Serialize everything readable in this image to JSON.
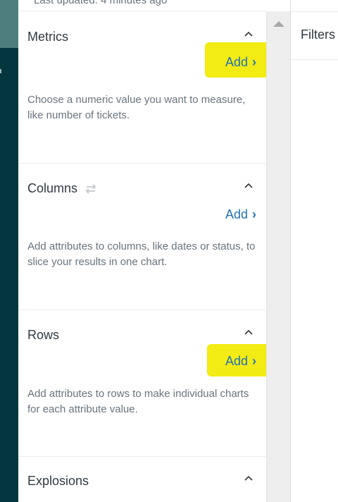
{
  "panel": {
    "updated_text": "Last updated: 4 minutes ago",
    "sections": [
      {
        "title": "Metrics",
        "add_label": "Add",
        "add_chevron": "›",
        "description": "Choose a numeric value you want to measure, like number of tickets.",
        "highlighted": true
      },
      {
        "title": "Columns",
        "icon": "swap-arrows-icon",
        "add_label": "Add",
        "add_chevron": "›",
        "description": "Add attributes to columns, like dates or status, to slice your results in one chart.",
        "highlighted": false
      },
      {
        "title": "Rows",
        "add_label": "Add",
        "add_chevron": "›",
        "description": "Add attributes to rows to make individual charts for each attribute value.",
        "highlighted": true
      },
      {
        "title": "Explosions"
      }
    ]
  },
  "filters": {
    "label": "Filters"
  },
  "colors": {
    "nav_dark": "#03363d",
    "nav_accent": "#4e7f7e",
    "link_blue": "#1f73b7",
    "highlight_yellow": "#f2e900"
  }
}
